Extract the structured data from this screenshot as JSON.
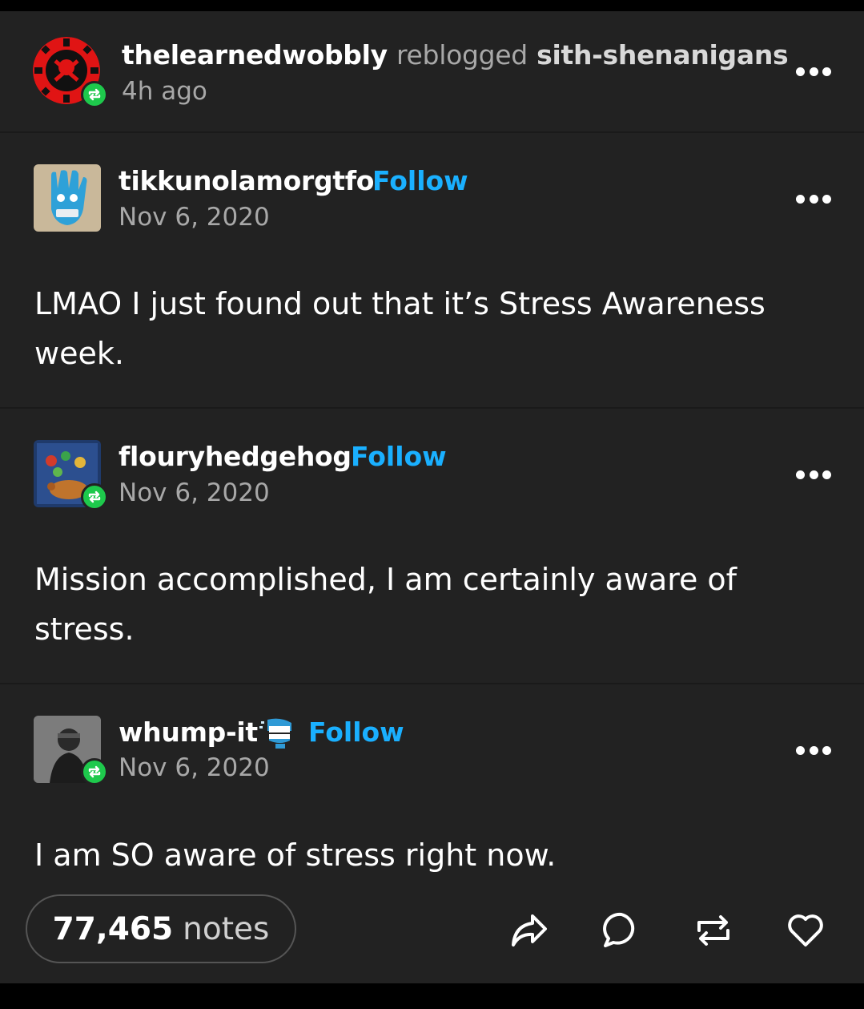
{
  "header": {
    "reblogger": "thelearnedwobbly",
    "action_word": "reblogged",
    "source": "sith-shenanigans",
    "time": "4h ago"
  },
  "posts": [
    {
      "username": "tikkunolamorgtfo",
      "follow_label": "Follow",
      "date": "Nov 6, 2020",
      "text": "LMAO I just found out that it’s Stress Awareness week."
    },
    {
      "username": "flouryhedgehog",
      "follow_label": "Follow",
      "date": "Nov 6, 2020",
      "text": "Mission accomplished, I am certainly aware of stress."
    },
    {
      "username": "whump-it",
      "follow_label": "Follow",
      "date": "Nov 6, 2020",
      "text": "I am SO aware of stress right now."
    }
  ],
  "footer": {
    "notes_count": "77,465",
    "notes_label": "notes"
  },
  "colors": {
    "background": "#222222",
    "follow_blue": "#1ab0ff",
    "reblog_green": "#1ec94c",
    "muted_text": "#a8a8a8"
  },
  "icons": [
    "reblog-badge-icon",
    "more-options-icon",
    "share-icon",
    "reply-icon",
    "reblog-icon",
    "like-icon",
    "wind-up-teeth-icon"
  ]
}
